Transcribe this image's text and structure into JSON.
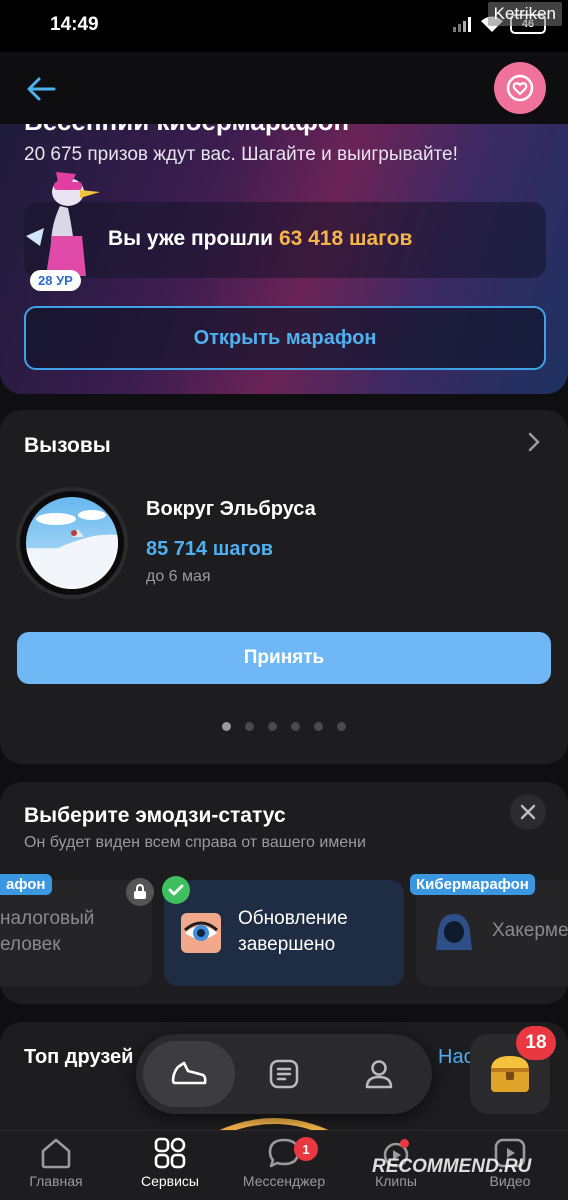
{
  "status_bar": {
    "time": "14:49",
    "battery": "46",
    "watermark": "Ketriken"
  },
  "header": {
    "back_icon": "arrow-left-icon",
    "heart_icon": "heart-icon"
  },
  "marathon": {
    "title": "Весенний кибермарафон",
    "subtitle": "20 675 призов ждут вас. Шагайте и выигрывайте!",
    "steps_prefix": "Вы уже прошли",
    "steps_value": "63 418 шагов",
    "level_badge": "28 УР",
    "open_button": "Открыть марафон",
    "accent_color": "#f5b44a"
  },
  "challenges": {
    "title": "Вызовы",
    "item": {
      "name": "Вокруг Эльбруса",
      "steps": "85 714 шагов",
      "deadline": "до 6 мая"
    },
    "accept_button": "Принять",
    "pager_total": 6,
    "pager_active": 1
  },
  "emoji_status": {
    "title": "Выберите эмодзи-статус",
    "subtitle": "Он будет виден всем справа от вашего имени",
    "tiles": [
      {
        "tag": "афон",
        "text_line1": "налоговый",
        "text_line2": "еловек"
      },
      {
        "text_line1": "Обновление",
        "text_line2": "завершено"
      },
      {
        "tag": "Кибермарафон",
        "text_line1": "Хакерме"
      }
    ]
  },
  "friends": {
    "title": "Топ друзей",
    "link": "Нас"
  },
  "floating": {
    "chest_count": "18"
  },
  "bottom_nav": {
    "items": [
      {
        "label": "Главная"
      },
      {
        "label": "Сервисы"
      },
      {
        "label": "Мессенджер",
        "badge": "1"
      },
      {
        "label": "Клипы"
      },
      {
        "label": "Видео"
      }
    ]
  },
  "watermark_bottom": "RECOMMEND.RU"
}
